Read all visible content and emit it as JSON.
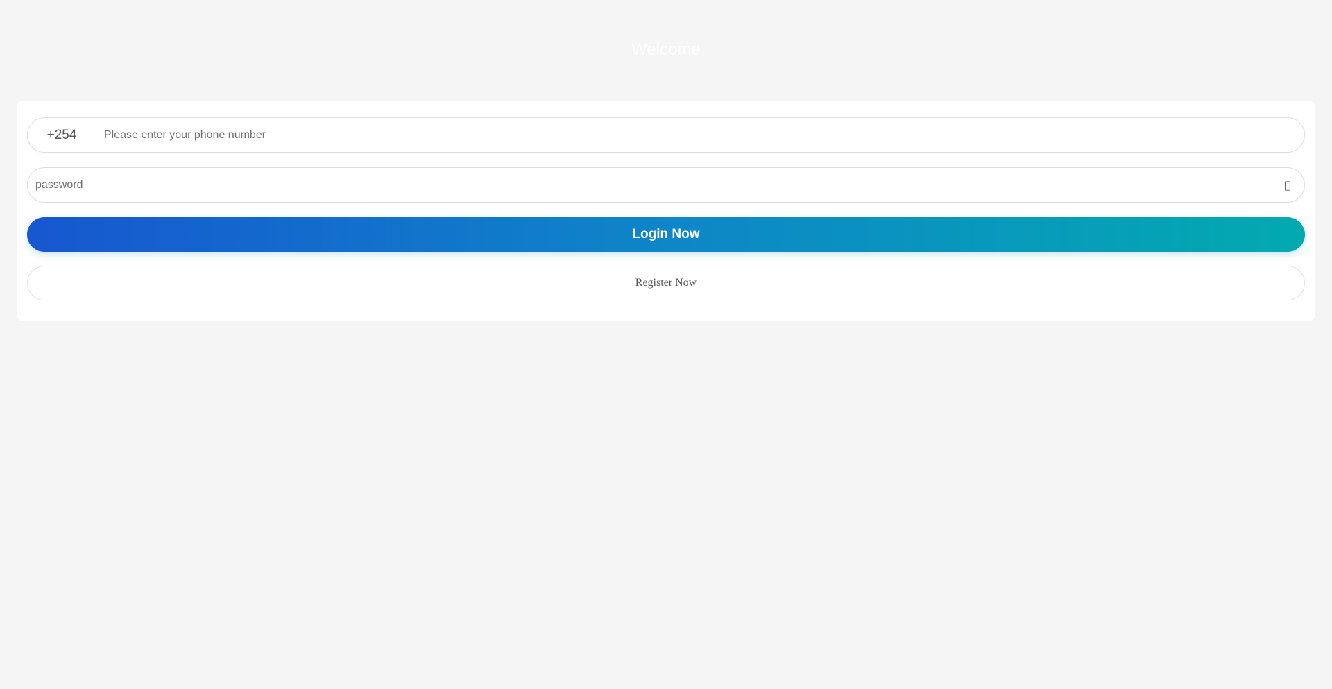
{
  "header": {
    "title": "Welcome"
  },
  "login_form": {
    "phone": {
      "country_code": "+254",
      "value": "",
      "placeholder": "Please enter your phone number"
    },
    "password": {
      "value": "",
      "placeholder": "password",
      "toggle_icon": "eye-icon",
      "toggle_glyph": ""
    },
    "login_label": "Login Now",
    "register_label": "Register Now"
  },
  "colors": {
    "page_background": "#f5f5f5",
    "card_background": "#ffffff",
    "login_gradient_start": "#1757d0",
    "login_gradient_end": "#02aab0",
    "welcome_text": "#ffffff"
  }
}
